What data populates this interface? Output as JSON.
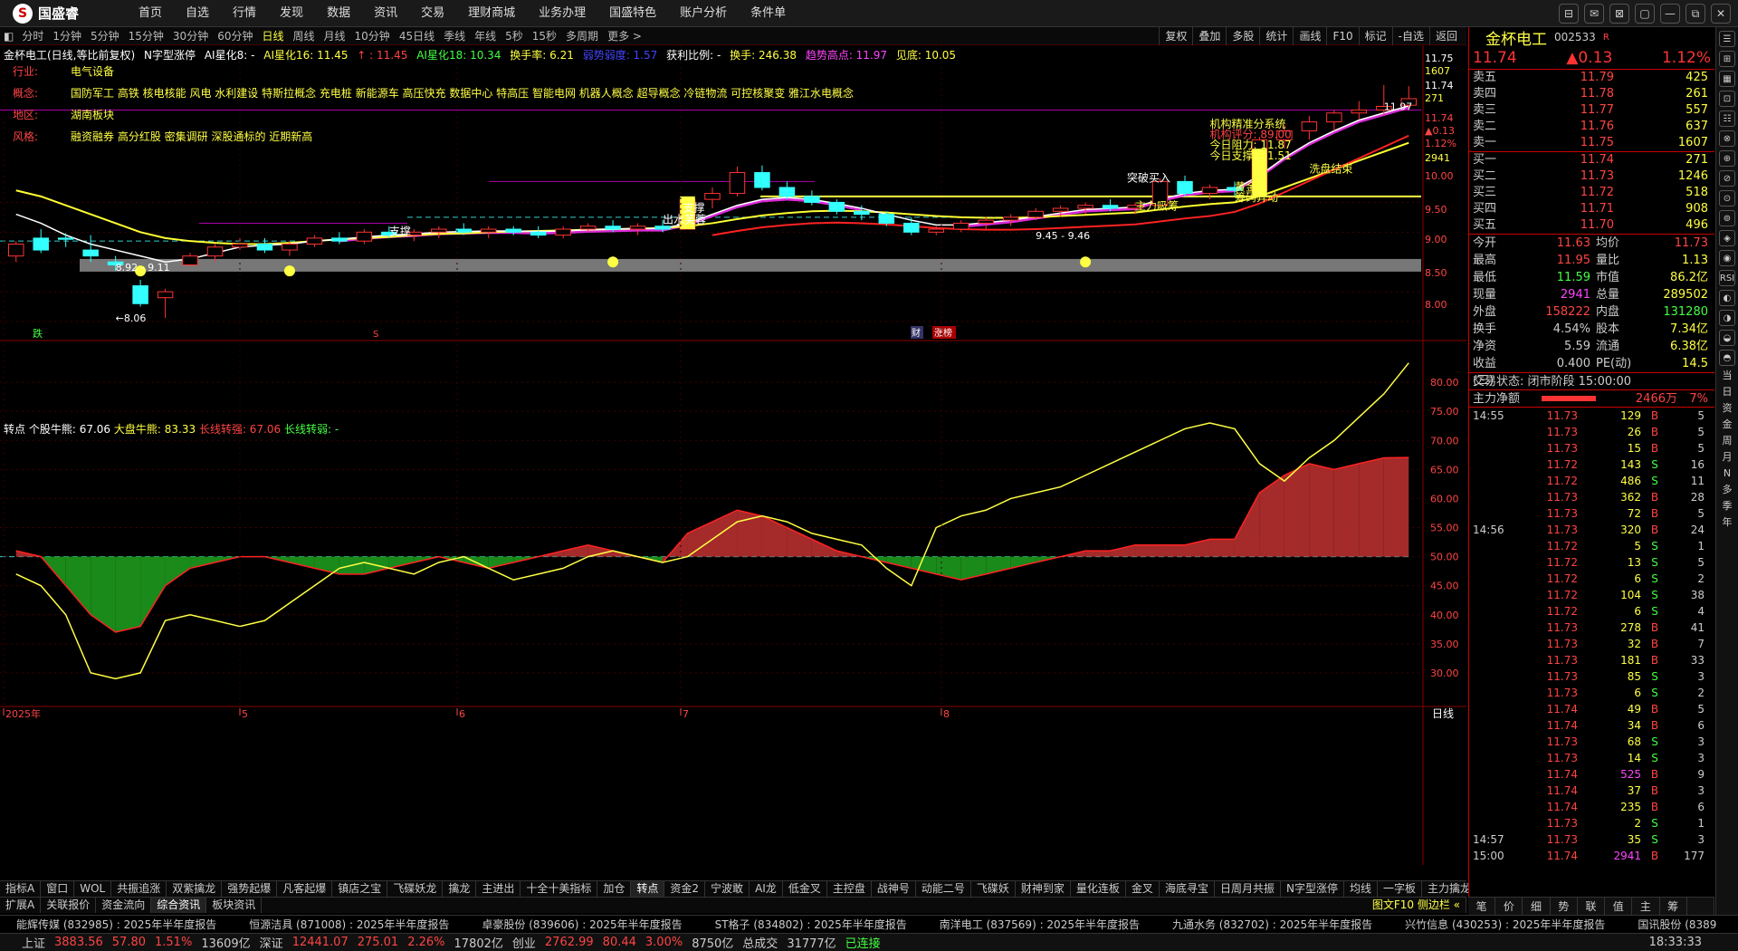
{
  "app": {
    "logo_text": "国盛睿",
    "menu": [
      "首页",
      "自选",
      "行情",
      "发现",
      "数据",
      "资讯",
      "交易",
      "理财商城",
      "业务办理",
      "国盛特色",
      "账户分析",
      "条件单"
    ],
    "window_controls": [
      "⊟",
      "✉",
      "⊠",
      "▢",
      "—",
      "⧉",
      "✕"
    ]
  },
  "periods": {
    "items": [
      "分时",
      "1分钟",
      "5分钟",
      "15分钟",
      "30分钟",
      "60分钟",
      "日线",
      "周线",
      "月线",
      "10分钟",
      "45日线",
      "季线",
      "年线",
      "5秒",
      "15秒",
      "多周期",
      "更多 >"
    ],
    "active": "日线",
    "tools": [
      "复权",
      "叠加",
      "多股",
      "统计",
      "画线",
      "F10",
      "标记",
      "-自选",
      "返回"
    ]
  },
  "legend": {
    "title": "金杯电工(日线,等比前复权)",
    "pattern": "N字型涨停",
    "ai8": "AI星化8: -",
    "ai16": "AI星化16: 11.45",
    "ai16b": "↑ : 11.45",
    "ai18": "AI星化18: 10.34",
    "turnover": "换手率: 6.21",
    "weak": "弱势弱度: 1.57",
    "profit": "获利比例: -",
    "hand": "换手: 246.38",
    "high": "趋势高点: 11.97",
    "low": "见底: 10.05"
  },
  "info": [
    {
      "key": "行业:",
      "val": "电气设备"
    },
    {
      "key": "概念:",
      "val": "国防军工 高铁 核电核能 风电 水利建设 特斯拉概念 充电桩 新能源车 高压快充 数据中心 特高压 智能电网 机器人概念 超导概念 冷链物流 可控核聚变 雅江水电概念"
    },
    {
      "key": "地区:",
      "val": "湖南板块"
    },
    {
      "key": "风格:",
      "val": "融资融券 高分红股 密集调研 深股通标的 近期新高"
    }
  ],
  "annotations": {
    "support1": "支撑",
    "out_lotus": "出水芙蓉",
    "support2": "支撑",
    "range1": "8.92 - 9.11",
    "low_mark": "←8.06",
    "range2": "9.45 - 9.46",
    "main_force": "主力吸筹",
    "wash_end": "洗盘结束",
    "break_buy": "突破买入",
    "golden_pit": "黄金坑",
    "chip_surge": "筹码异动",
    "high_mark": "11.97",
    "system": "机构精准分系统",
    "score": "机构评分: 89.00",
    "resist": "今日阻力: 11.87",
    "support_today": "今日支撑: 11.51",
    "marker_die": "跌",
    "marker_cai": "财",
    "marker_zhang": "涨榜",
    "marker_s": "S"
  },
  "price_axis": [
    "11.75",
    "1607",
    "11.74",
    "271",
    "11.74",
    "▲0.13",
    "1.12%",
    "2941",
    "10.00",
    "9.50",
    "9.00",
    "8.50",
    "8.00"
  ],
  "sub_legend": {
    "name": "转点",
    "bull": "个股牛熊: 67.06",
    "market": "大盘牛熊: 83.33",
    "long_strong": "长线转强: 67.06",
    "long_weak": "长线转弱: -"
  },
  "sub_axis": [
    "80.00",
    "75.00",
    "70.00",
    "65.00",
    "60.00",
    "55.00",
    "50.00",
    "45.00",
    "40.00",
    "35.00",
    "30.00"
  ],
  "date_axis": [
    "2025年",
    "5",
    "6",
    "7",
    "8"
  ],
  "period_label": "日线",
  "tabs_row1": [
    "指标A",
    "窗口",
    "WOL",
    "共振追涨",
    "双紫擒龙",
    "强势起爆",
    "凡客起爆",
    "镇店之宝",
    "飞碟妖龙",
    "擒龙",
    "主进出",
    "十全十美指标",
    "加仓",
    "转点",
    "资金2",
    "宁波敢",
    "AI龙",
    "低金叉",
    "主控盘",
    "战神号",
    "动能二号",
    "飞碟妖",
    "财神到家",
    "量化连板",
    "金叉",
    "海底寻宝",
    "日周月共振",
    "N字型涨停",
    "均线",
    "一字板",
    "主力擒龙",
    "指标B",
    "模",
    "板"
  ],
  "tabs_row2": [
    "扩展A",
    "关联报价",
    "资金流向",
    "综合资讯",
    "板块资讯"
  ],
  "tabs_row2_right": "图文F10 侧边栏 «",
  "news": [
    "能辉传媒 (832985) : 2025年半年度报告",
    "恒源洁具 (871008) : 2025年半年度报告",
    "卓豪股份 (839606) : 2025年半年度报告",
    "ST格子 (834802) : 2025年半年度报告",
    "南洋电工 (837569) : 2025年半年度报告",
    "九通水务 (832702) : 2025年半年度报告",
    "兴竹信息 (430253) : 2025年半年度报告",
    "国讯股份 (8389"
  ],
  "status": {
    "sh_label": "上证",
    "sh_val": "3883.56",
    "sh_chg": "57.80",
    "sh_pct": "1.51%",
    "sh_amt": "13609亿",
    "sz_label": "深证",
    "sz_val": "12441.07",
    "sz_chg": "275.01",
    "sz_pct": "2.26%",
    "sz_amt": "17802亿",
    "cy_label": "创业",
    "cy_val": "2762.99",
    "cy_chg": "80.44",
    "cy_pct": "3.00%",
    "cy_amt": "8750亿",
    "total_label": "总成交",
    "total_val": "31777亿",
    "conn": "已连接",
    "time": "18:33:33"
  },
  "quote": {
    "name": "金杯电工",
    "code": "002533",
    "code_suffix": "R",
    "price": "11.74",
    "change": "▲0.13",
    "pct": "1.12%",
    "asks": [
      {
        "label": "卖五",
        "price": "11.79",
        "vol": "425"
      },
      {
        "label": "卖四",
        "price": "11.78",
        "vol": "261"
      },
      {
        "label": "卖三",
        "price": "11.77",
        "vol": "557"
      },
      {
        "label": "卖二",
        "price": "11.76",
        "vol": "637"
      },
      {
        "label": "卖一",
        "price": "11.75",
        "vol": "1607"
      }
    ],
    "bids": [
      {
        "label": "买一",
        "price": "11.74",
        "vol": "271"
      },
      {
        "label": "买二",
        "price": "11.73",
        "vol": "1246"
      },
      {
        "label": "买三",
        "price": "11.72",
        "vol": "518"
      },
      {
        "label": "买四",
        "price": "11.71",
        "vol": "908"
      },
      {
        "label": "买五",
        "price": "11.70",
        "vol": "496"
      }
    ],
    "stats": [
      {
        "k": "今开",
        "v": "11.63",
        "k2": "均价",
        "v2": "11.73"
      },
      {
        "k": "最高",
        "v": "11.95",
        "k2": "量比",
        "v2": "1.13"
      },
      {
        "k": "最低",
        "v": "11.59",
        "k2": "市值",
        "v2": "86.2亿"
      },
      {
        "k": "现量",
        "v": "2941",
        "k2": "总量",
        "v2": "289502"
      },
      {
        "k": "外盘",
        "v": "158222",
        "k2": "内盘",
        "v2": "131280"
      },
      {
        "k": "换手",
        "v": "4.54%",
        "k2": "股本",
        "v2": "7.34亿"
      },
      {
        "k": "净资",
        "v": "5.59",
        "k2": "流通",
        "v2": "6.38亿"
      },
      {
        "k": "收益(三)",
        "v": "0.400",
        "k2": "PE(动)",
        "v2": "14.5"
      }
    ],
    "trade_state": "交易状态: 闭市阶段 15:00:00",
    "mainflow_label": "主力净额",
    "mainflow_val": "2466万",
    "mainflow_pct": "7%",
    "ticks": [
      {
        "t": "14:55",
        "p": "11.73",
        "v": "129",
        "bs": "B",
        "n": "5"
      },
      {
        "t": "",
        "p": "11.73",
        "v": "26",
        "bs": "B",
        "n": "5"
      },
      {
        "t": "",
        "p": "11.73",
        "v": "15",
        "bs": "B",
        "n": "5"
      },
      {
        "t": "",
        "p": "11.72",
        "v": "143",
        "bs": "S",
        "n": "16"
      },
      {
        "t": "",
        "p": "11.72",
        "v": "486",
        "bs": "S",
        "n": "11"
      },
      {
        "t": "",
        "p": "11.73",
        "v": "362",
        "bs": "B",
        "n": "28"
      },
      {
        "t": "",
        "p": "11.73",
        "v": "72",
        "bs": "B",
        "n": "5"
      },
      {
        "t": "14:56",
        "p": "11.73",
        "v": "320",
        "bs": "B",
        "n": "24"
      },
      {
        "t": "",
        "p": "11.72",
        "v": "5",
        "bs": "S",
        "n": "1"
      },
      {
        "t": "",
        "p": "11.72",
        "v": "13",
        "bs": "S",
        "n": "5"
      },
      {
        "t": "",
        "p": "11.72",
        "v": "6",
        "bs": "S",
        "n": "2"
      },
      {
        "t": "",
        "p": "11.72",
        "v": "104",
        "bs": "S",
        "n": "38"
      },
      {
        "t": "",
        "p": "11.72",
        "v": "6",
        "bs": "S",
        "n": "4"
      },
      {
        "t": "",
        "p": "11.73",
        "v": "278",
        "bs": "B",
        "n": "41"
      },
      {
        "t": "",
        "p": "11.73",
        "v": "32",
        "bs": "B",
        "n": "7"
      },
      {
        "t": "",
        "p": "11.73",
        "v": "181",
        "bs": "B",
        "n": "33"
      },
      {
        "t": "",
        "p": "11.73",
        "v": "85",
        "bs": "S",
        "n": "3"
      },
      {
        "t": "",
        "p": "11.73",
        "v": "6",
        "bs": "S",
        "n": "2"
      },
      {
        "t": "",
        "p": "11.74",
        "v": "49",
        "bs": "B",
        "n": "5"
      },
      {
        "t": "",
        "p": "11.74",
        "v": "34",
        "bs": "B",
        "n": "6"
      },
      {
        "t": "",
        "p": "11.73",
        "v": "68",
        "bs": "S",
        "n": "3"
      },
      {
        "t": "",
        "p": "11.73",
        "v": "14",
        "bs": "S",
        "n": "3"
      },
      {
        "t": "",
        "p": "11.74",
        "v": "525",
        "bs": "B",
        "n": "9"
      },
      {
        "t": "",
        "p": "11.74",
        "v": "37",
        "bs": "B",
        "n": "3"
      },
      {
        "t": "",
        "p": "11.74",
        "v": "235",
        "bs": "B",
        "n": "6"
      },
      {
        "t": "",
        "p": "11.73",
        "v": "2",
        "bs": "S",
        "n": "1"
      },
      {
        "t": "14:57",
        "p": "11.73",
        "v": "35",
        "bs": "S",
        "n": "3"
      },
      {
        "t": "15:00",
        "p": "11.74",
        "v": "2941",
        "bs": "B",
        "n": "177"
      }
    ],
    "bottom_tabs": [
      "笔",
      "价",
      "细",
      "势",
      "联",
      "值",
      "主",
      "筹",
      ""
    ]
  },
  "side_strip": [
    "☰",
    "⊞",
    "▦",
    "⊡",
    "☷",
    "⊗",
    "⊕",
    "⊘",
    "⊙",
    "⊚",
    "◈",
    "◉",
    "RSI",
    "◐",
    "◑",
    "◒",
    "◓"
  ],
  "side_text": [
    "当",
    "日",
    "资",
    "金",
    "周",
    "月",
    "N",
    "多",
    "季",
    "年"
  ],
  "colors": {
    "up": "#ff3333",
    "down": "#33ffff",
    "ma_white": "#ffffff",
    "ma_yellow": "#ffff33",
    "ma_magenta": "#ff33ff",
    "red_fill": "#a52a2a",
    "green_fill": "#1a8a1a"
  },
  "chart_data": {
    "type": "candlestick",
    "title": "金杯电工(日线,等比前复权)",
    "ylim": [
      8.0,
      11.8
    ],
    "x": [
      "2025-04",
      "2025-05",
      "2025-06",
      "2025-07",
      "2025-08"
    ],
    "ohlc": [
      [
        9.1,
        9.35,
        9.0,
        9.3
      ],
      [
        9.4,
        9.55,
        9.15,
        9.2
      ],
      [
        9.4,
        9.48,
        9.25,
        9.38
      ],
      [
        9.2,
        9.45,
        9.0,
        9.1
      ],
      [
        9.0,
        9.1,
        8.85,
        8.95
      ],
      [
        8.6,
        8.7,
        8.25,
        8.3
      ],
      [
        8.4,
        8.55,
        8.06,
        8.5
      ],
      [
        8.95,
        9.15,
        8.92,
        9.1
      ],
      [
        9.1,
        9.3,
        9.0,
        9.25
      ],
      [
        9.25,
        9.4,
        9.2,
        9.3
      ],
      [
        9.3,
        9.4,
        9.15,
        9.2
      ],
      [
        9.2,
        9.35,
        9.1,
        9.3
      ],
      [
        9.3,
        9.45,
        9.25,
        9.4
      ],
      [
        9.4,
        9.5,
        9.3,
        9.35
      ],
      [
        9.35,
        9.55,
        9.3,
        9.5
      ],
      [
        9.5,
        9.6,
        9.4,
        9.45
      ],
      [
        9.45,
        9.55,
        9.35,
        9.5
      ],
      [
        9.5,
        9.6,
        9.4,
        9.55
      ],
      [
        9.55,
        9.65,
        9.45,
        9.5
      ],
      [
        9.5,
        9.6,
        9.4,
        9.55
      ],
      [
        9.55,
        9.6,
        9.45,
        9.5
      ],
      [
        9.5,
        9.6,
        9.4,
        9.45
      ],
      [
        9.45,
        9.6,
        9.4,
        9.55
      ],
      [
        9.55,
        9.65,
        9.5,
        9.6
      ],
      [
        9.6,
        9.7,
        9.5,
        9.55
      ],
      [
        9.55,
        9.65,
        9.45,
        9.6
      ],
      [
        9.6,
        9.7,
        9.5,
        9.55
      ],
      [
        9.55,
        10.1,
        9.55,
        10.05
      ],
      [
        10.05,
        10.25,
        9.9,
        10.15
      ],
      [
        10.15,
        10.6,
        10.1,
        10.5
      ],
      [
        10.5,
        10.62,
        10.2,
        10.25
      ],
      [
        10.25,
        10.35,
        10.05,
        10.1
      ],
      [
        10.1,
        10.2,
        9.95,
        10.0
      ],
      [
        10.0,
        10.05,
        9.8,
        9.85
      ],
      [
        9.85,
        9.95,
        9.7,
        9.8
      ],
      [
        9.8,
        9.85,
        9.6,
        9.65
      ],
      [
        9.65,
        9.75,
        9.45,
        9.5
      ],
      [
        9.5,
        9.6,
        9.45,
        9.55
      ],
      [
        9.55,
        9.7,
        9.5,
        9.65
      ],
      [
        9.65,
        9.75,
        9.55,
        9.7
      ],
      [
        9.7,
        9.8,
        9.6,
        9.75
      ],
      [
        9.75,
        9.9,
        9.7,
        9.85
      ],
      [
        9.85,
        9.95,
        9.75,
        9.9
      ],
      [
        9.9,
        10.0,
        9.8,
        9.95
      ],
      [
        9.95,
        10.05,
        9.85,
        9.9
      ],
      [
        9.9,
        10.0,
        9.8,
        9.95
      ],
      [
        9.95,
        10.4,
        9.9,
        10.35
      ],
      [
        10.35,
        10.45,
        10.1,
        10.15
      ],
      [
        10.15,
        10.3,
        10.05,
        10.25
      ],
      [
        10.25,
        10.35,
        10.1,
        10.2
      ],
      [
        10.2,
        11.1,
        10.15,
        11.05
      ],
      [
        11.05,
        11.3,
        10.9,
        11.2
      ],
      [
        11.2,
        11.45,
        11.05,
        11.35
      ],
      [
        11.35,
        11.55,
        11.2,
        11.5
      ],
      [
        11.5,
        11.7,
        11.4,
        11.55
      ],
      [
        11.55,
        11.97,
        11.45,
        11.61
      ],
      [
        11.63,
        11.95,
        11.59,
        11.74
      ]
    ],
    "ma_white": [
      9.8,
      9.65,
      9.45,
      9.3,
      9.2,
      9.1,
      9.0,
      9.05,
      9.15,
      9.25,
      9.28,
      9.3,
      9.35,
      9.38,
      9.42,
      9.45,
      9.47,
      9.5,
      9.51,
      9.52,
      9.52,
      9.51,
      9.52,
      9.54,
      9.55,
      9.56,
      9.56,
      9.65,
      9.8,
      9.95,
      10.05,
      10.08,
      10.05,
      9.98,
      9.9,
      9.8,
      9.7,
      9.62,
      9.62,
      9.66,
      9.7,
      9.76,
      9.82,
      9.88,
      9.9,
      9.92,
      10.05,
      10.15,
      10.2,
      10.22,
      10.45,
      10.75,
      11.0,
      11.2,
      11.38,
      11.5,
      11.62
    ],
    "ma_yellow": [
      10.2,
      10.1,
      9.95,
      9.8,
      9.65,
      9.5,
      9.4,
      9.35,
      9.32,
      9.3,
      9.3,
      9.32,
      9.35,
      9.38,
      9.4,
      9.42,
      9.45,
      9.47,
      9.48,
      9.5,
      9.51,
      9.52,
      9.53,
      9.54,
      9.55,
      9.56,
      9.57,
      9.6,
      9.65,
      9.72,
      9.78,
      9.82,
      9.85,
      9.86,
      9.85,
      9.83,
      9.8,
      9.77,
      9.75,
      9.74,
      9.74,
      9.75,
      9.77,
      9.79,
      9.81,
      9.83,
      9.88,
      9.93,
      9.97,
      10.0,
      10.1,
      10.25,
      10.4,
      10.55,
      10.7,
      10.85,
      11.0
    ],
    "sub": {
      "name": "转点",
      "ylim": [
        25,
        85
      ],
      "bull": [
        51,
        50,
        45,
        40,
        37,
        38,
        45,
        48,
        49,
        50,
        50,
        49,
        48,
        47,
        47,
        48,
        49,
        50,
        49,
        48,
        49,
        50,
        51,
        52,
        51,
        50,
        49,
        54,
        56,
        58,
        57,
        55,
        53,
        51,
        50,
        49,
        48,
        47,
        46,
        47,
        48,
        49,
        50,
        51,
        51,
        52,
        52,
        52,
        53,
        53,
        61,
        64,
        66,
        65,
        66,
        67,
        67.06
      ],
      "market": [
        47,
        45,
        40,
        30,
        29,
        30,
        39,
        40,
        39,
        38,
        39,
        42,
        45,
        48,
        49,
        48,
        47,
        49,
        50,
        48,
        46,
        47,
        48,
        50,
        51,
        50,
        49,
        50,
        53,
        56,
        57,
        56,
        54,
        53,
        52,
        48,
        45,
        55,
        57,
        58,
        60,
        61,
        62,
        64,
        66,
        68,
        70,
        72,
        73,
        72,
        66,
        63,
        67,
        70,
        74,
        78,
        83.33
      ]
    }
  }
}
